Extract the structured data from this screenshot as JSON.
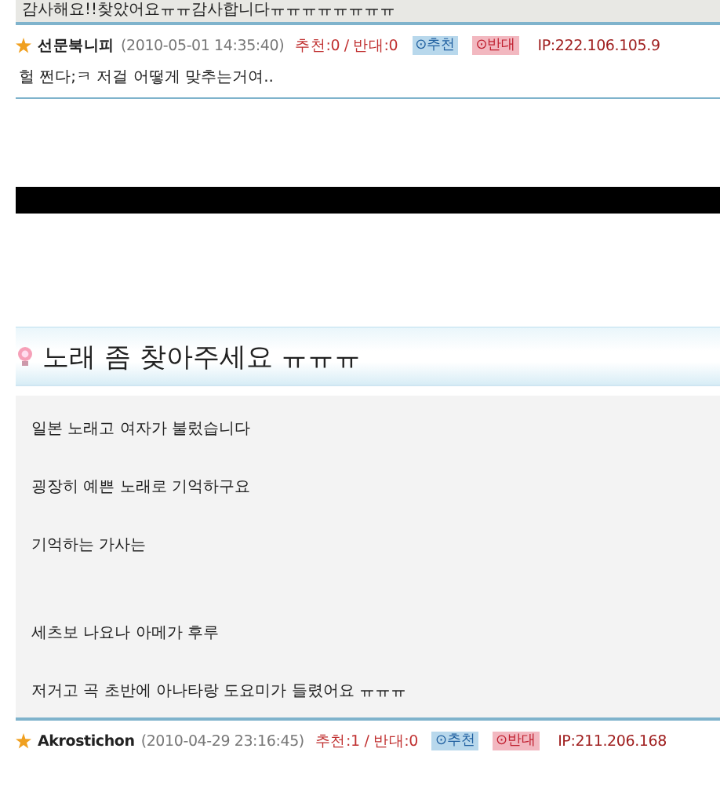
{
  "previous_post": {
    "text": "감사해요!!찾았어요ㅠㅠ감사합니다ㅠㅠㅠㅠㅠㅠㅠㅠ"
  },
  "comments_top": [
    {
      "author": "선문북니피",
      "time": "(2010-05-01 14:35:40)",
      "votes": "추천:0 / 반대:0",
      "up": "⊙추천",
      "down": "⊙반대",
      "ip": "IP:222.106.105.9",
      "text": "헐 쩐다;ㅋ 저걸 어떻게 맞추는거여.."
    }
  ],
  "post": {
    "title": "노래 좀 찾아주세요 ㅠㅠㅠ",
    "paragraphs": [
      "일본 노래고 여자가 불렀습니다",
      "굉장히 예쁜 노래로 기억하구요",
      "기억하는 가사는",
      "세츠보 나요나 아메가 후루",
      "저거고 곡 초반에 아나타랑 도요미가 들렸어요 ㅠㅠㅠ"
    ]
  },
  "comments_bottom": [
    {
      "author": "Akrostichon",
      "time": "(2010-04-29 23:16:45)",
      "votes": "추천:1 / 반대:0",
      "up": "⊙추천",
      "down": "⊙반대",
      "ip": "IP:211.206.168"
    }
  ]
}
